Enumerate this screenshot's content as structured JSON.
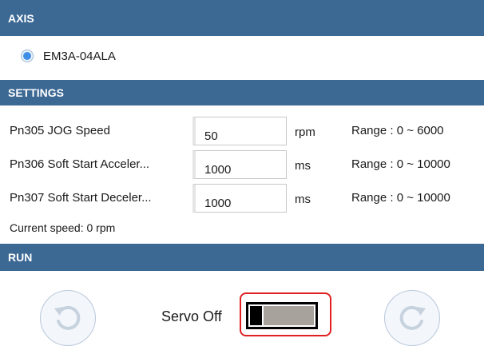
{
  "sections": {
    "axis": "AXIS",
    "settings": "SETTINGS",
    "run": "RUN"
  },
  "axis": {
    "selected": true,
    "label": "EM3A-04ALA"
  },
  "settings": {
    "params": [
      {
        "label": "Pn305 JOG Speed",
        "value": "50",
        "unit": "rpm",
        "range": "Range :  0  ~  6000"
      },
      {
        "label": "Pn306 Soft Start Acceler...",
        "value": "1000",
        "unit": "ms",
        "range": "Range :  0  ~  10000"
      },
      {
        "label": "Pn307 Soft Start Deceler...",
        "value": "1000",
        "unit": "ms",
        "range": "Range :  0  ~  10000"
      }
    ],
    "current_speed": "Current speed: 0 rpm"
  },
  "run": {
    "servo_label": "Servo Off",
    "servo_on": false,
    "ccw_icon": "rotate-ccw-icon",
    "cw_icon": "rotate-cw-icon"
  },
  "colors": {
    "section_bar": "#3c6894",
    "radio_dot": "#3f8ee6",
    "highlight_border": "#e02020",
    "toggle_track": "#a7a29b"
  }
}
